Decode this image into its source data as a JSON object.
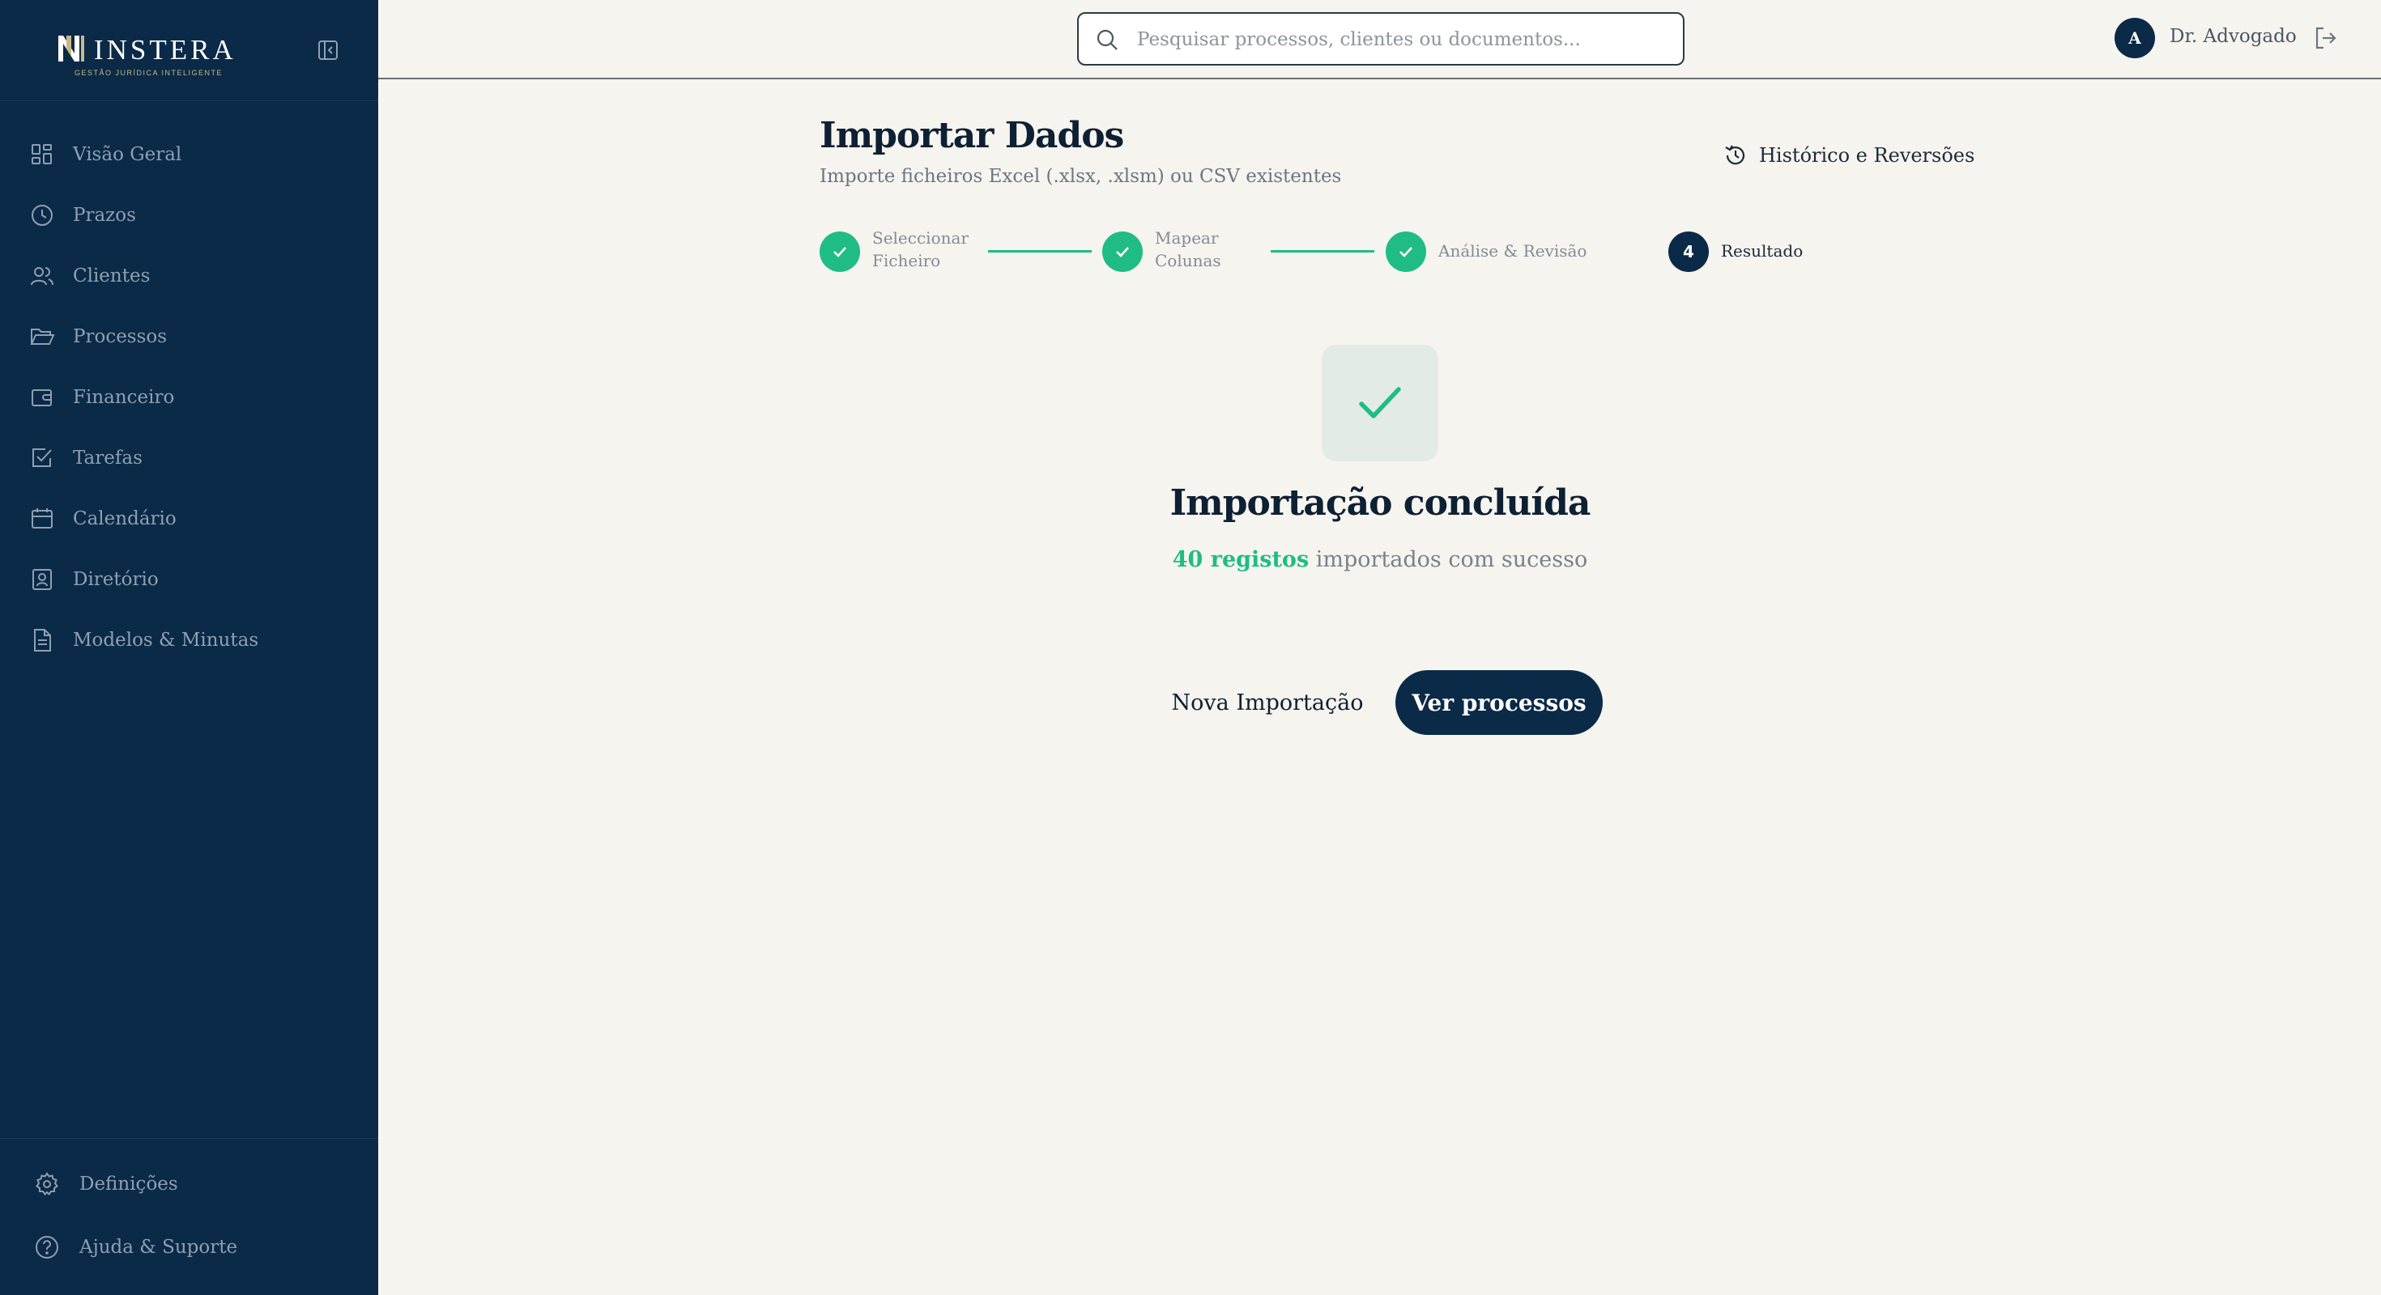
{
  "brand": {
    "name": "INSTERA",
    "tagline": "GESTÃO JURÍDICA INTELIGENTE",
    "logo_icon": "instera-logo-icon"
  },
  "sidebar": {
    "collapse_icon": "sidebar-collapse-icon",
    "items": [
      {
        "label": "Visão Geral",
        "icon": "dashboard-grid-icon"
      },
      {
        "label": "Prazos",
        "icon": "clock-icon"
      },
      {
        "label": "Clientes",
        "icon": "users-icon"
      },
      {
        "label": "Processos",
        "icon": "folder-open-icon"
      },
      {
        "label": "Financeiro",
        "icon": "wallet-icon"
      },
      {
        "label": "Tarefas",
        "icon": "checkbox-icon"
      },
      {
        "label": "Calendário",
        "icon": "calendar-icon"
      },
      {
        "label": "Diretório",
        "icon": "contact-book-icon"
      },
      {
        "label": "Modelos & Minutas",
        "icon": "document-icon"
      }
    ],
    "footer": [
      {
        "label": "Definições",
        "icon": "gear-icon"
      },
      {
        "label": "Ajuda & Suporte",
        "icon": "help-circle-icon"
      }
    ]
  },
  "topbar": {
    "search_placeholder": "Pesquisar processos, clientes ou documentos...",
    "avatar_initial": "A",
    "user_name": "Dr. Advogado",
    "logout_icon": "logout-icon"
  },
  "page": {
    "title": "Importar Dados",
    "subtitle": "Importe ficheiros Excel (.xlsx, .xlsm) ou CSV existentes",
    "history_label": "Histórico e Reversões"
  },
  "stepper": {
    "steps": [
      {
        "line1": "Seleccionar",
        "line2": "Ficheiro",
        "status": "done"
      },
      {
        "line1": "Mapear",
        "line2": "Colunas",
        "status": "done"
      },
      {
        "line1": "Análise & Revisão",
        "line2": "",
        "status": "done"
      },
      {
        "number": "4",
        "line1": "Resultado",
        "line2": "",
        "status": "active"
      }
    ]
  },
  "result": {
    "title": "Importação concluída",
    "count_text": "40 registos",
    "rest_text": " importados com sucesso",
    "icon": "check-icon"
  },
  "actions": {
    "new_import": "Nova Importação",
    "view_processes": "Ver processos"
  },
  "colors": {
    "sidebar_bg": "#0a2a47",
    "accent_green": "#1fbd83",
    "page_bg": "#f6f4ef",
    "primary_button": "#0a2a47"
  }
}
